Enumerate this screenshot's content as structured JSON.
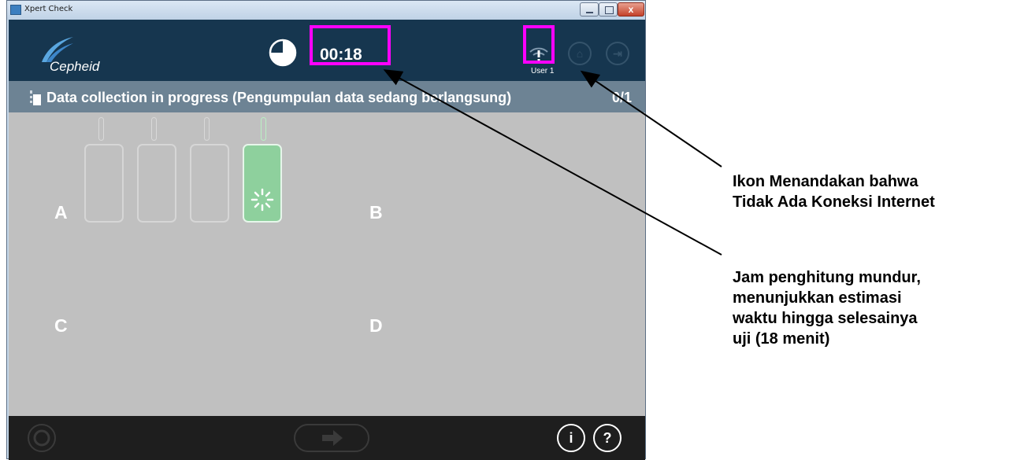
{
  "window": {
    "title": "Xpert Check",
    "close_glyph": "x"
  },
  "header": {
    "logo": "Cepheid",
    "timer": "00:18",
    "timer_progress_fraction": 0.75,
    "user": "User 1",
    "network_icon": "wifi-no-connection-icon",
    "home_icon": "home-icon",
    "exit_icon": "exit-icon"
  },
  "status": {
    "text": "Data collection in progress (Pengumpulan data sedang berlangsung)",
    "count": "0/1"
  },
  "modules": {
    "slots": [
      "A",
      "B",
      "C",
      "D"
    ],
    "active_module_index": 4
  },
  "footer": {
    "info_label": "i",
    "help_label": "?"
  },
  "annotations": {
    "network": "Ikon Menandakan bahwa Tidak Ada Koneksi Internet",
    "network_lines": [
      "Ikon Menandakan bahwa",
      "Tidak Ada Koneksi Internet"
    ],
    "clock_lines": [
      "Jam penghitung mundur,",
      "menunjukkan estimasi",
      "waktu hingga selesainya",
      "uji (18 menit)"
    ]
  },
  "colors": {
    "header_bg": "#16364f",
    "status_bg": "#6d8394",
    "main_bg": "#c0c0c0",
    "active_module": "#8ed09d",
    "highlight": "#ff00ff"
  }
}
